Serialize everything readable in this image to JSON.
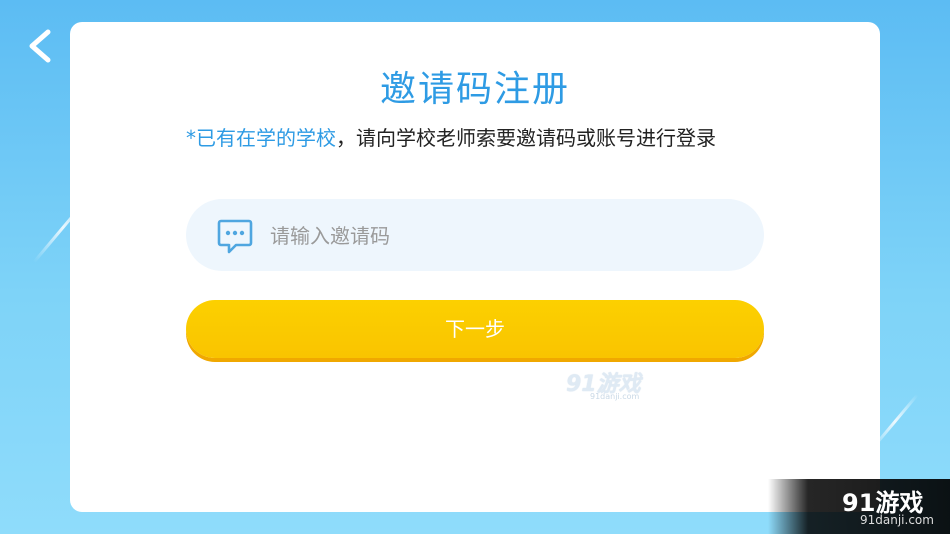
{
  "screen": {
    "background_color": "#6cc7f6"
  },
  "nav": {
    "back_icon": "chevron-left-icon"
  },
  "card": {
    "title": "邀请码注册",
    "notice_highlight": "*已有在学的学校",
    "notice_rest": "，请向学校老师索要邀请码或账号进行登录",
    "input": {
      "icon": "chat-bubble-icon",
      "placeholder": "请输入邀请码",
      "value": ""
    },
    "next_button_label": "下一步"
  },
  "watermarks": {
    "center_main": "91游戏",
    "center_sub": "91danji.com",
    "corner_main": "91游戏",
    "corner_sub": "91danji.com"
  },
  "colors": {
    "accent_blue": "#2e9be4",
    "button_yellow": "#fcd000",
    "input_bg": "#eef6fd"
  }
}
